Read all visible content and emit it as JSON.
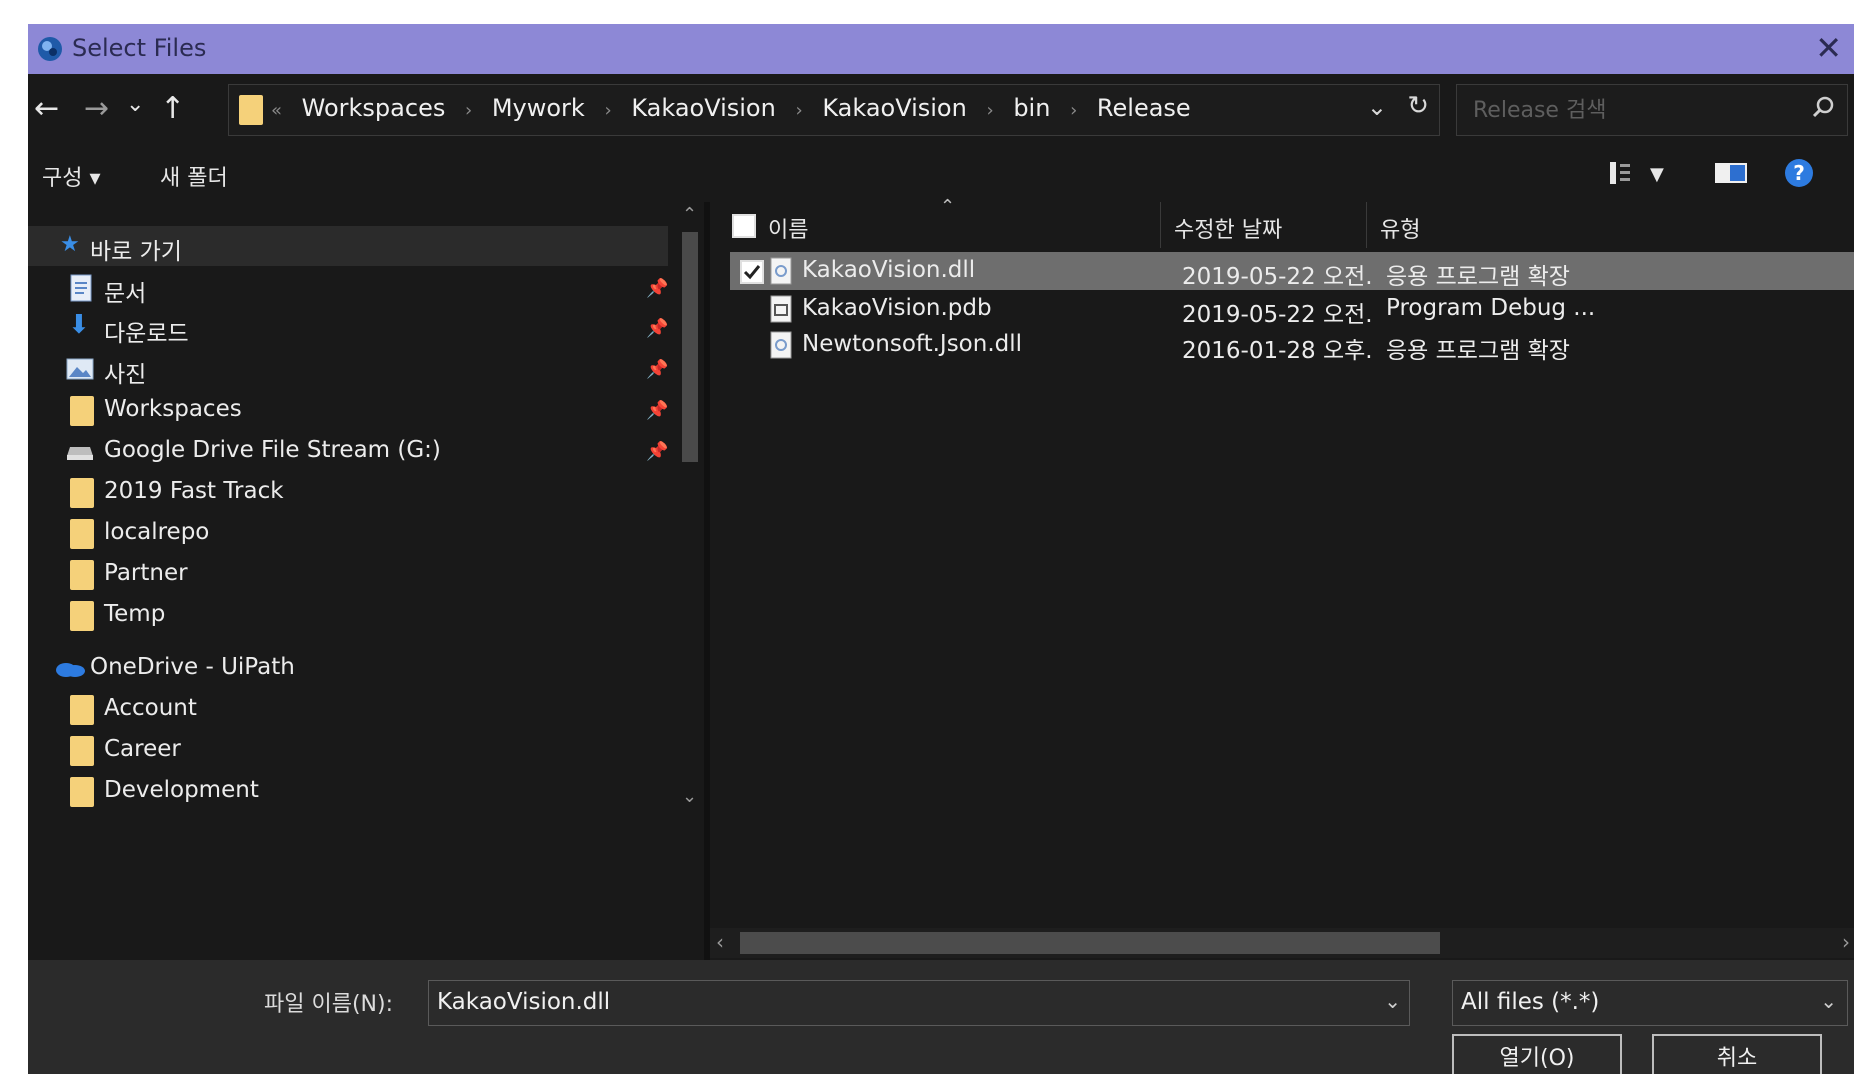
{
  "window": {
    "title": "Select Files",
    "close_glyph": "✕"
  },
  "nav": {
    "back": "←",
    "forward": "→",
    "recent": "⌄",
    "up": "↑",
    "breadcrumb_prefix": "«",
    "breadcrumbs": [
      "Workspaces",
      "Mywork",
      "KakaoVision",
      "KakaoVision",
      "bin",
      "Release"
    ],
    "search_placeholder": "Release 검색"
  },
  "toolbar": {
    "organize": "구성 ▾",
    "new_folder": "새 폴더"
  },
  "navpane": {
    "quick_access": "바로 가기",
    "items": [
      {
        "label": "문서",
        "icon": "document-icon",
        "pinned": true
      },
      {
        "label": "다운로드",
        "icon": "download-icon",
        "pinned": true
      },
      {
        "label": "사진",
        "icon": "picture-icon",
        "pinned": true
      },
      {
        "label": "Workspaces",
        "icon": "folder-icon",
        "pinned": true
      },
      {
        "label": "Google Drive File Stream (G:)",
        "icon": "drive-icon",
        "pinned": true
      },
      {
        "label": "2019 Fast Track",
        "icon": "folder-icon",
        "pinned": false
      },
      {
        "label": "localrepo",
        "icon": "folder-icon",
        "pinned": false
      },
      {
        "label": "Partner",
        "icon": "folder-icon",
        "pinned": false
      },
      {
        "label": "Temp",
        "icon": "folder-icon",
        "pinned": false
      }
    ],
    "onedrive": "OneDrive - UiPath",
    "onedrive_items": [
      "Account",
      "Career",
      "Development"
    ]
  },
  "filelist": {
    "columns": {
      "name": "이름",
      "date": "수정한 날짜",
      "type": "유형"
    },
    "rows": [
      {
        "name": "KakaoVision.dll",
        "date": "2019-05-22 오전...",
        "type": "응용 프로그램 확장",
        "selected": true
      },
      {
        "name": "KakaoVision.pdb",
        "date": "2019-05-22 오전...",
        "type": "Program Debug ...",
        "selected": false
      },
      {
        "name": "Newtonsoft.Json.dll",
        "date": "2016-01-28 오후...",
        "type": "응용 프로그램 확장",
        "selected": false
      }
    ]
  },
  "bottom": {
    "filename_label": "파일 이름(N):",
    "filename_value": "KakaoVision.dll",
    "filter_value": "All files (*.*)",
    "open_button": "열기(O)",
    "cancel_button": "취소"
  }
}
